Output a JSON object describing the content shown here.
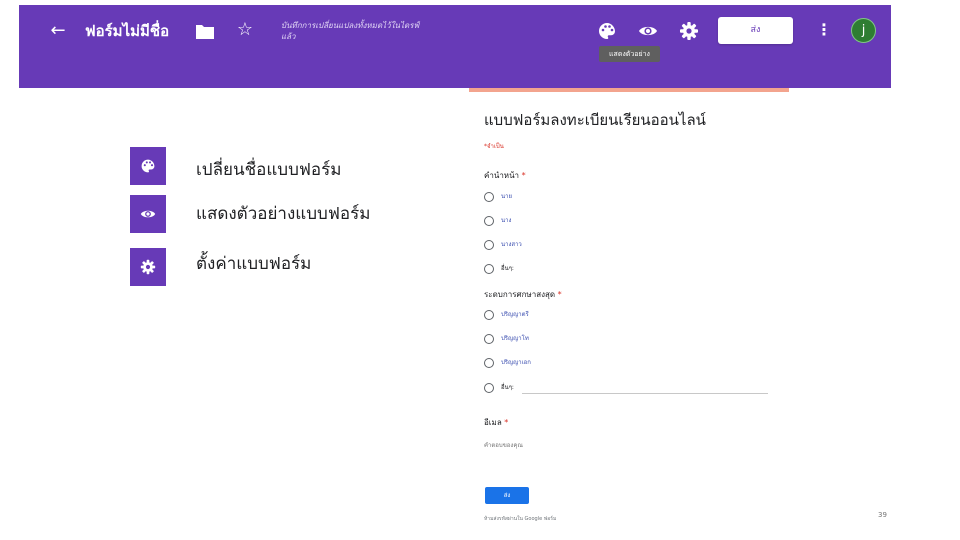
{
  "header": {
    "back_icon": "arrow-left-icon",
    "title": "ฟอร์มไม่มีชื่อ",
    "folder_icon": "folder-icon",
    "star_icon": "star-icon",
    "saved_text": "บันทึกการเปลี่ยนแปลงทั้งหมดไว้ในไดรฟ์แล้ว",
    "palette_icon": "palette-icon",
    "preview_icon": "eye-icon",
    "settings_icon": "gear-icon",
    "send_label": "ส่ง",
    "more_icon": "more-vert-icon",
    "avatar_letter": "j",
    "tooltip": "แสดงตัวอย่าง",
    "bar_color": "#673ab7"
  },
  "legend": [
    {
      "icon": "palette-icon",
      "label": "เปลี่ยนชื่อแบบฟอร์ม"
    },
    {
      "icon": "eye-icon",
      "label": "แสดงตัวอย่างแบบฟอร์ม"
    },
    {
      "icon": "gear-icon",
      "label": "ตั้งค่าแบบฟอร์ม"
    }
  ],
  "form": {
    "accent_color": "#f3a48e",
    "title": "แบบฟอร์มลงทะเบียนเรียนออนไลน์",
    "required_note": "*จำเป็น",
    "questions": [
      {
        "label": "คำนำหน้า",
        "required_mark": "*",
        "options": [
          "นาย",
          "นาง",
          "นางสาว",
          "อื่นๆ:"
        ]
      },
      {
        "label": "ระดบการศกษาสงสุด",
        "required_mark": "*",
        "options": [
          "ปริญญาตรี",
          "ปริญญาโท",
          "ปริญญาเอก",
          "อื่นๆ:"
        ]
      },
      {
        "label": "อีเมล",
        "required_mark": "*",
        "placeholder": "คำตอบของคุณ"
      }
    ],
    "submit_label": "ส่ง",
    "footer_note": "ห้ามส่งรหัสผ่านใน Google ฟอร์ม"
  },
  "page_number": "39"
}
